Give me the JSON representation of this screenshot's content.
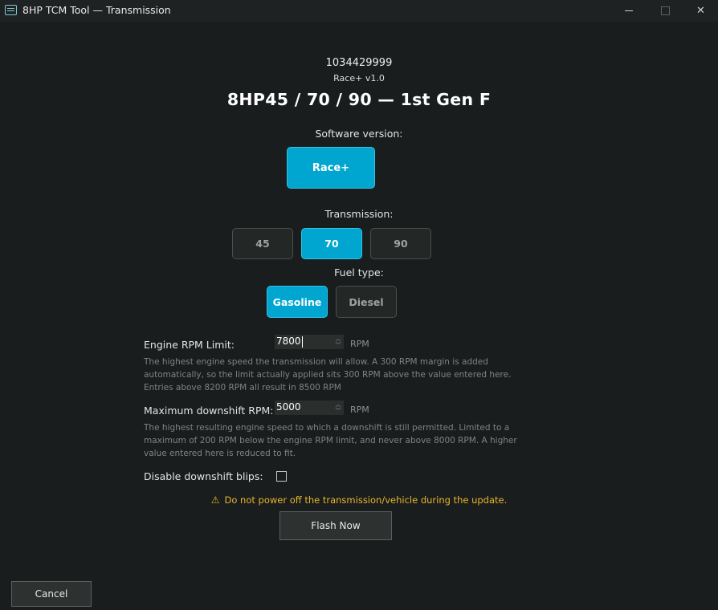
{
  "window": {
    "title": "8HP TCM Tool — Transmission",
    "icon": "app-icon",
    "close_glyph": "✕"
  },
  "header": {
    "serial": "1034429999",
    "version": "Race+ v1.0",
    "title": "8HP45 / 70 / 90  —  1st Gen F"
  },
  "software": {
    "label": "Software version:",
    "options": [
      {
        "label": "Race+",
        "selected": true
      }
    ]
  },
  "transmission": {
    "label": "Transmission:",
    "options": [
      {
        "label": "45",
        "selected": false
      },
      {
        "label": "70",
        "selected": true
      },
      {
        "label": "90",
        "selected": false
      }
    ]
  },
  "fuel": {
    "label": "Fuel type:",
    "options": [
      {
        "label": "Gasoline",
        "selected": true
      },
      {
        "label": "Diesel",
        "selected": false
      }
    ]
  },
  "rpm_limit": {
    "label": "Engine RPM Limit:",
    "value": "7800",
    "unit": "RPM",
    "help": "The highest engine speed the transmission will allow. A 300 RPM margin is added automatically, so the limit actually applied sits 300 RPM above the value entered here. Entries above 8200 RPM all result in 8500 RPM"
  },
  "downshift_rpm": {
    "label": "Maximum downshift RPM:",
    "value": "5000",
    "unit": "RPM",
    "help": "The highest resulting engine speed to which a downshift is still permitted. Limited to a maximum of 200 RPM below the engine RPM limit, and never above 8000 RPM. A higher value entered here is reduced to fit."
  },
  "blips": {
    "label": "Disable downshift blips:",
    "checked": false
  },
  "warning": {
    "icon": "warning-icon",
    "text": "Do not power off the transmission/vehicle during the update.",
    "color": "#e7b52c"
  },
  "actions": {
    "flash_label": "Flash Now",
    "cancel_label": "Cancel"
  },
  "colors": {
    "accent": "#00a6cf",
    "background": "#1a1d1d"
  }
}
